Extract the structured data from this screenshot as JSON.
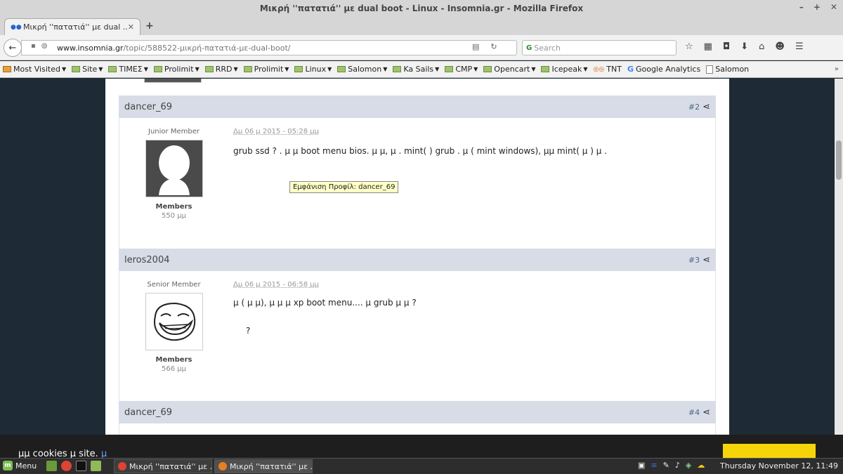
{
  "window": {
    "title": "Μικρή ''πατατιά'' με dual boot - Linux - Insomnia.gr - Mozilla Firefox"
  },
  "tab": {
    "label": "Μικρή ''πατατιά'' με dual ..."
  },
  "navbar": {
    "url_host": "www.insomnia.gr",
    "url_path": "/topic/588522-μικρή-πατατιά-με-dual-boot/",
    "search_placeholder": "Search"
  },
  "bookmarks": [
    {
      "label": "Most Visited",
      "type": "special"
    },
    {
      "label": "Site",
      "type": "folder"
    },
    {
      "label": "TIMEΣ",
      "type": "folder"
    },
    {
      "label": "Prolimit",
      "type": "folder"
    },
    {
      "label": "RRD",
      "type": "folder"
    },
    {
      "label": "Prolimit",
      "type": "folder"
    },
    {
      "label": "Linux",
      "type": "folder"
    },
    {
      "label": "Salomon",
      "type": "folder"
    },
    {
      "label": "Ka Sails",
      "type": "folder"
    },
    {
      "label": "CMP",
      "type": "folder"
    },
    {
      "label": "Opencart",
      "type": "folder"
    },
    {
      "label": "Icepeak",
      "type": "folder"
    },
    {
      "label": "TNT",
      "type": "tnt"
    },
    {
      "label": "Google Analytics",
      "type": "google"
    },
    {
      "label": "Salomon",
      "type": "page"
    }
  ],
  "posts": {
    "p1": {
      "author": "dancer_69",
      "number": "#2",
      "rank": "Junior Member",
      "date": "Δμ 06 μ 2015 - 05:28 μμ",
      "group": "Members",
      "count": "550 μμ",
      "text": "grub  ssd  ?    . μ    μ  boot menu   bios.   μ  μ,    μ      .      mint(  )   grub  .     μ    ( mint   windows),   μμ    mint( μ )  μ      ."
    },
    "p2": {
      "author": "leros2004",
      "number": "#3",
      "rank": "Senior Member",
      "date": "Δμ 06 μ 2015 - 06:58 μμ",
      "group": "Members",
      "count": "566 μμ",
      "text1": "μ    (   μ μ), μ  μ    μ      xp    boot menu....  μ   grub  μ  μ ?",
      "text2": "?"
    },
    "p3": {
      "author": "dancer_69",
      "number": "#4"
    }
  },
  "tooltip": "Εμφάνιση Προφίλ: dancer_69",
  "cookie": {
    "text": "μμ cookies    μ   site.",
    "link": "μ"
  },
  "taskbar": {
    "menu_label": "Menu",
    "task1": "Μικρή ''πατατιά'' με ...",
    "task2": "Μικρή ''πατατιά'' με ...",
    "clock": "Thursday November 12, 11:49"
  }
}
